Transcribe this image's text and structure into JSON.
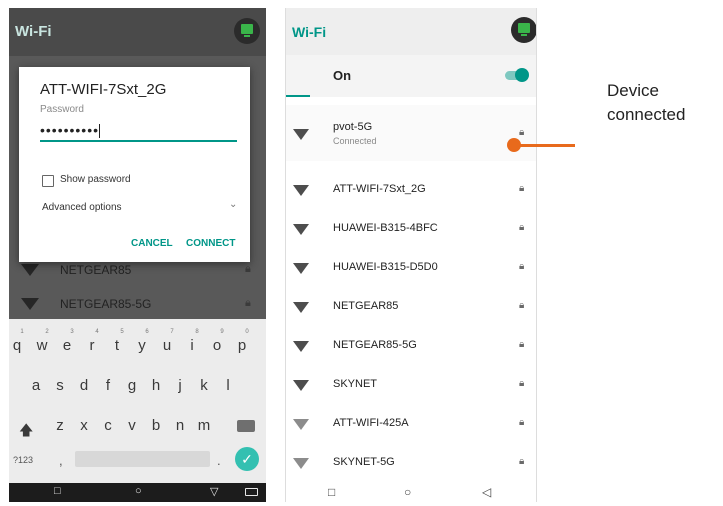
{
  "left_screen": {
    "title": "Wi-Fi",
    "dialog": {
      "network_name": "ATT-WIFI-7Sxt_2G",
      "password_label": "Password",
      "password_value": "••••••••••",
      "show_password_label": "Show password",
      "advanced_options_label": "Advanced options",
      "cancel_label": "CANCEL",
      "connect_label": "CONNECT"
    },
    "background_networks": [
      "NETGEAR85",
      "NETGEAR85-5G"
    ],
    "keyboard": {
      "row1": [
        "q",
        "w",
        "e",
        "r",
        "t",
        "y",
        "u",
        "i",
        "o",
        "p"
      ],
      "row1_hints": [
        "1",
        "2",
        "3",
        "4",
        "5",
        "6",
        "7",
        "8",
        "9",
        "0"
      ],
      "row2": [
        "a",
        "s",
        "d",
        "f",
        "g",
        "h",
        "j",
        "k",
        "l"
      ],
      "row3": [
        "z",
        "x",
        "c",
        "v",
        "b",
        "n",
        "m"
      ],
      "symbols_label": "?123",
      "comma": ",",
      "period": "."
    },
    "navbar": {
      "back": "▽",
      "home": "○",
      "recents": "□"
    }
  },
  "right_screen": {
    "title": "Wi-Fi",
    "toggle_label": "On",
    "toggle_on": true,
    "networks": [
      {
        "name": "pvot-5G",
        "status": "Connected",
        "locked": true
      },
      {
        "name": "ATT-WIFI-7Sxt_2G",
        "locked": true
      },
      {
        "name": "HUAWEI-B315-4BFC",
        "locked": true
      },
      {
        "name": "HUAWEI-B315-D5D0",
        "locked": true
      },
      {
        "name": "NETGEAR85",
        "locked": true
      },
      {
        "name": "NETGEAR85-5G",
        "locked": true
      },
      {
        "name": "SKYNET",
        "locked": true
      },
      {
        "name": "ATT-WIFI-425A",
        "locked": true
      },
      {
        "name": "SKYNET-5G",
        "locked": true
      }
    ],
    "navbar": {
      "back": "◁",
      "home": "○",
      "recents": "□"
    }
  },
  "annotation": {
    "line1": "Device",
    "line2": "connected"
  },
  "colors": {
    "accent": "#009688",
    "callout": "#e86a1c"
  },
  "icons": [
    "wifi-icon",
    "lock-icon",
    "settings-badge-icon",
    "shift-icon",
    "backspace-icon",
    "check-icon"
  ]
}
